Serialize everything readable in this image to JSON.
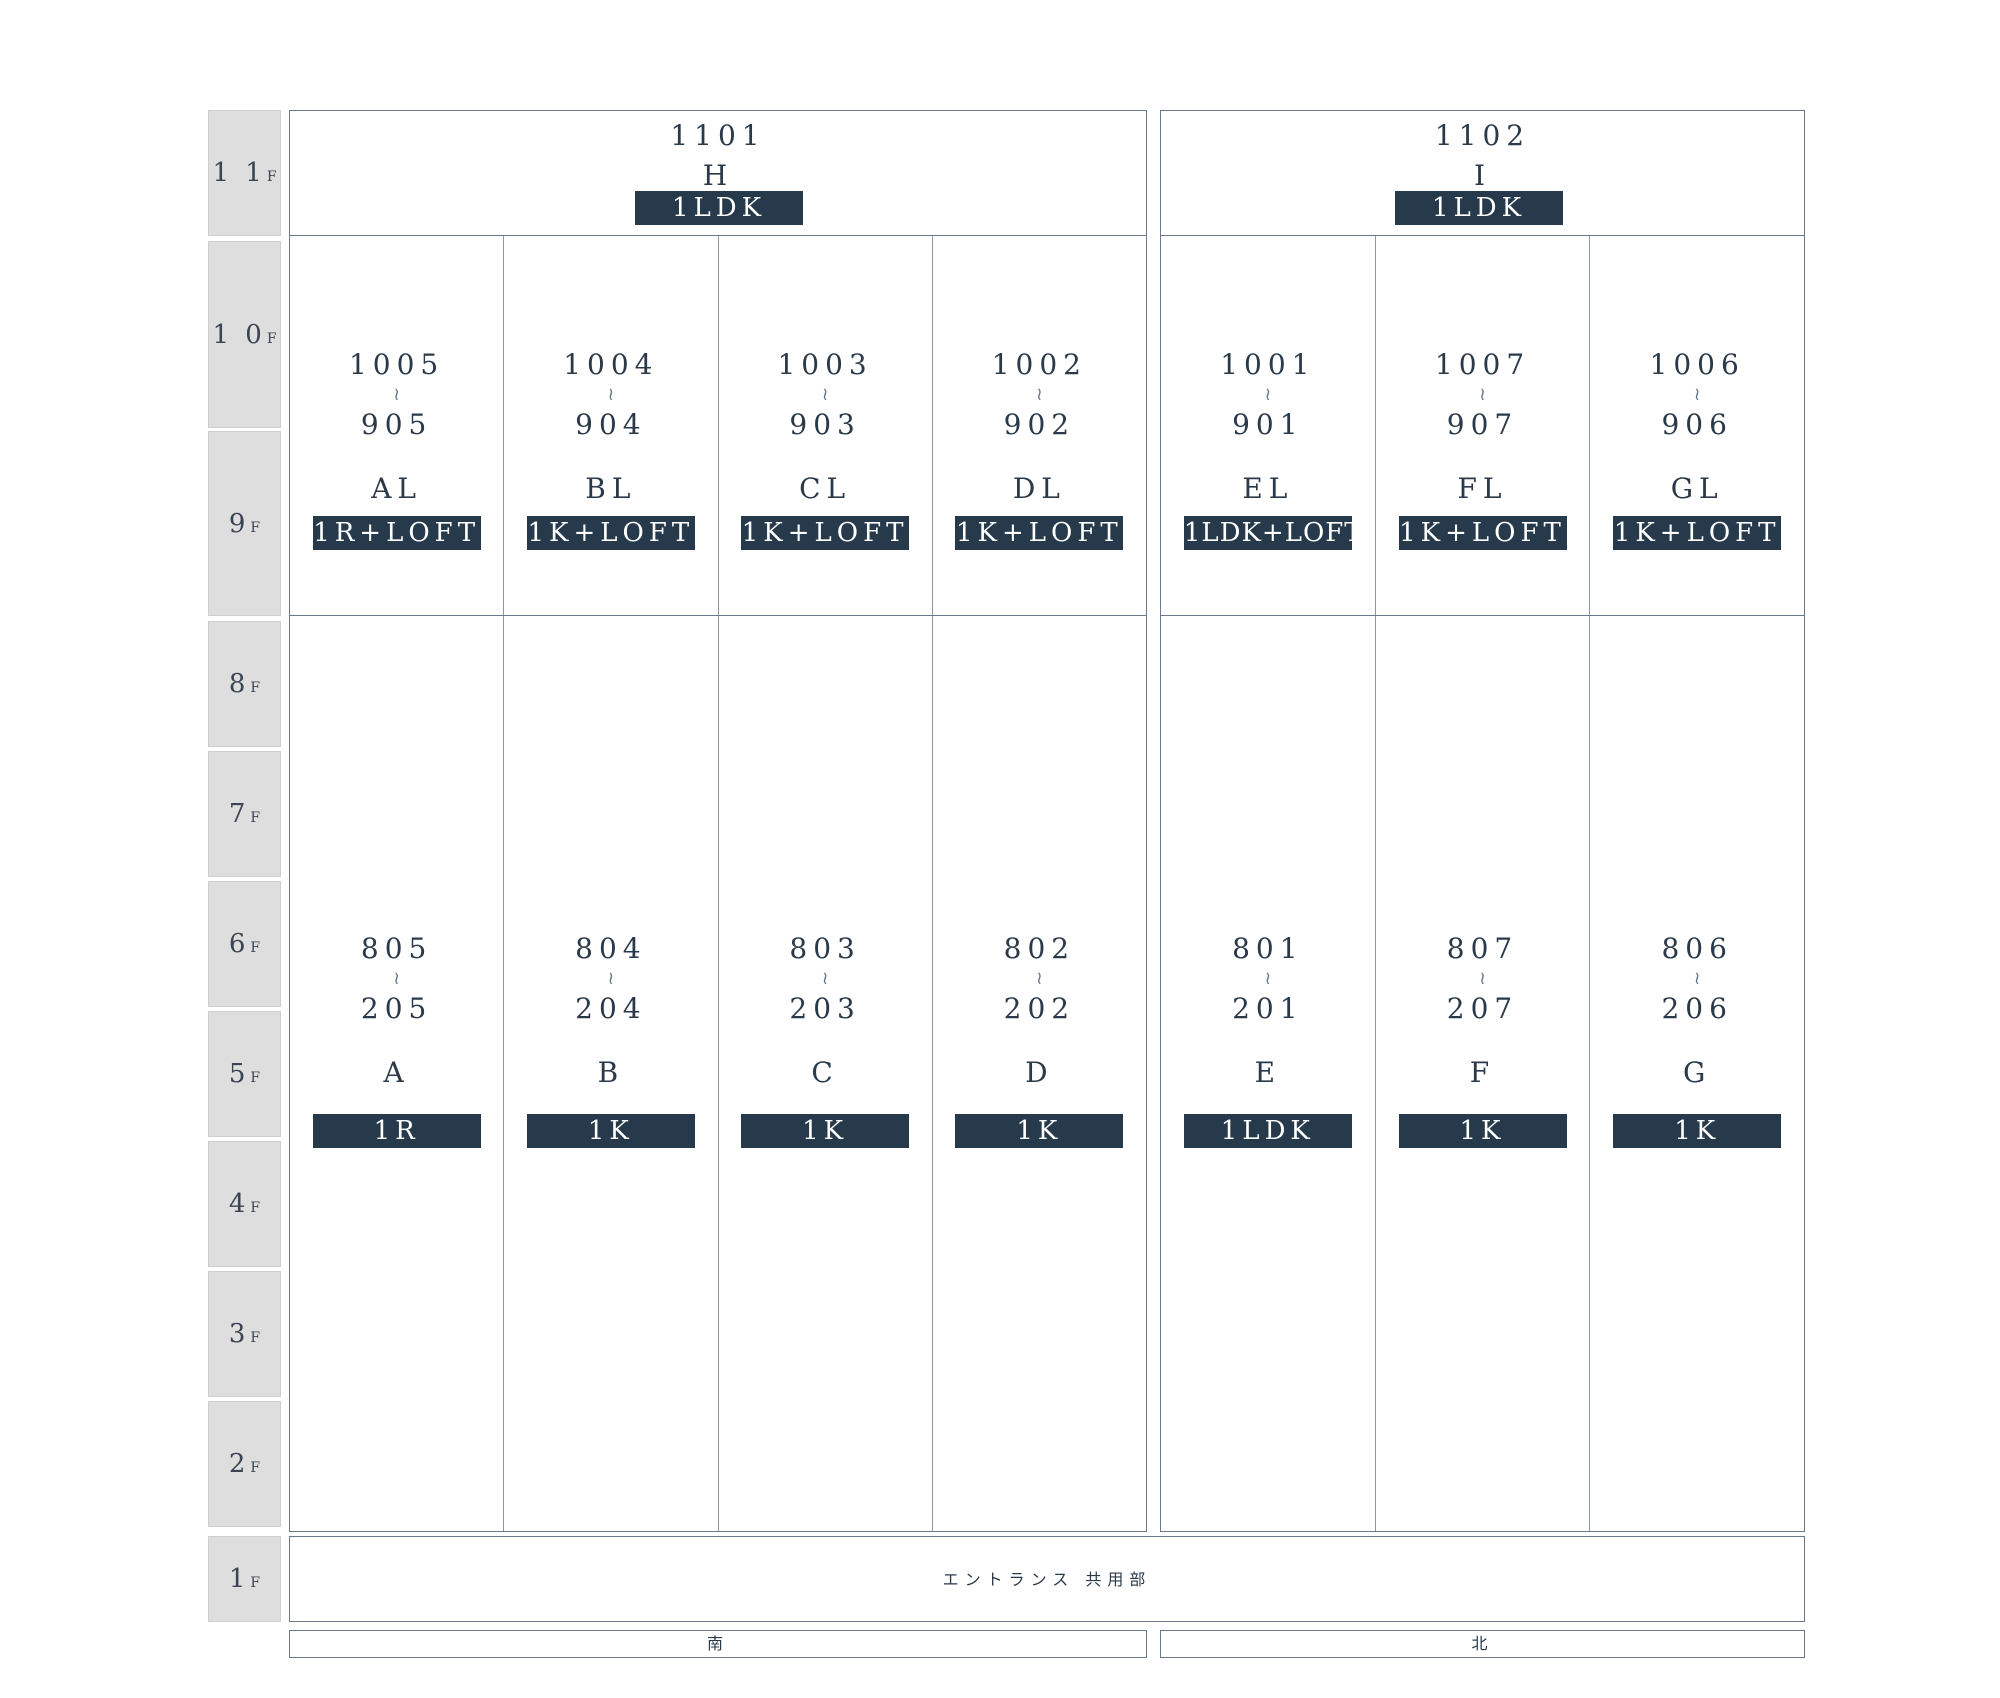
{
  "floors": [
    {
      "n": "1 1",
      "f": "F"
    },
    {
      "n": "1 0",
      "f": "F"
    },
    {
      "n": "9",
      "f": "F"
    },
    {
      "n": "8",
      "f": "F"
    },
    {
      "n": "7",
      "f": "F"
    },
    {
      "n": "6",
      "f": "F"
    },
    {
      "n": "5",
      "f": "F"
    },
    {
      "n": "4",
      "f": "F"
    },
    {
      "n": "3",
      "f": "F"
    },
    {
      "n": "2",
      "f": "F"
    },
    {
      "n": "1",
      "f": "F"
    }
  ],
  "top": [
    {
      "number": "1101",
      "type": "H",
      "layout": "1LDK"
    },
    {
      "number": "1102",
      "type": "I",
      "layout": "1LDK"
    }
  ],
  "mid": [
    {
      "upper": "1005",
      "lower": "905",
      "type": "AL",
      "layout": "1R+LOFT"
    },
    {
      "upper": "1004",
      "lower": "904",
      "type": "BL",
      "layout": "1K+LOFT"
    },
    {
      "upper": "1003",
      "lower": "903",
      "type": "CL",
      "layout": "1K+LOFT"
    },
    {
      "upper": "1002",
      "lower": "902",
      "type": "DL",
      "layout": "1K+LOFT"
    },
    {
      "upper": "1001",
      "lower": "901",
      "type": "EL",
      "layout": "1LDK+LOFT"
    },
    {
      "upper": "1007",
      "lower": "907",
      "type": "FL",
      "layout": "1K+LOFT"
    },
    {
      "upper": "1006",
      "lower": "906",
      "type": "GL",
      "layout": "1K+LOFT"
    }
  ],
  "low": [
    {
      "upper": "805",
      "lower": "205",
      "type": "A",
      "layout": "1R"
    },
    {
      "upper": "804",
      "lower": "204",
      "type": "B",
      "layout": "1K"
    },
    {
      "upper": "803",
      "lower": "203",
      "type": "C",
      "layout": "1K"
    },
    {
      "upper": "802",
      "lower": "202",
      "type": "D",
      "layout": "1K"
    },
    {
      "upper": "801",
      "lower": "201",
      "type": "E",
      "layout": "1LDK"
    },
    {
      "upper": "807",
      "lower": "207",
      "type": "F",
      "layout": "1K"
    },
    {
      "upper": "806",
      "lower": "206",
      "type": "G",
      "layout": "1K"
    }
  ],
  "tilde": "≀",
  "ground": "エントランス 共用部",
  "sides": {
    "south": "南",
    "north": "北"
  }
}
